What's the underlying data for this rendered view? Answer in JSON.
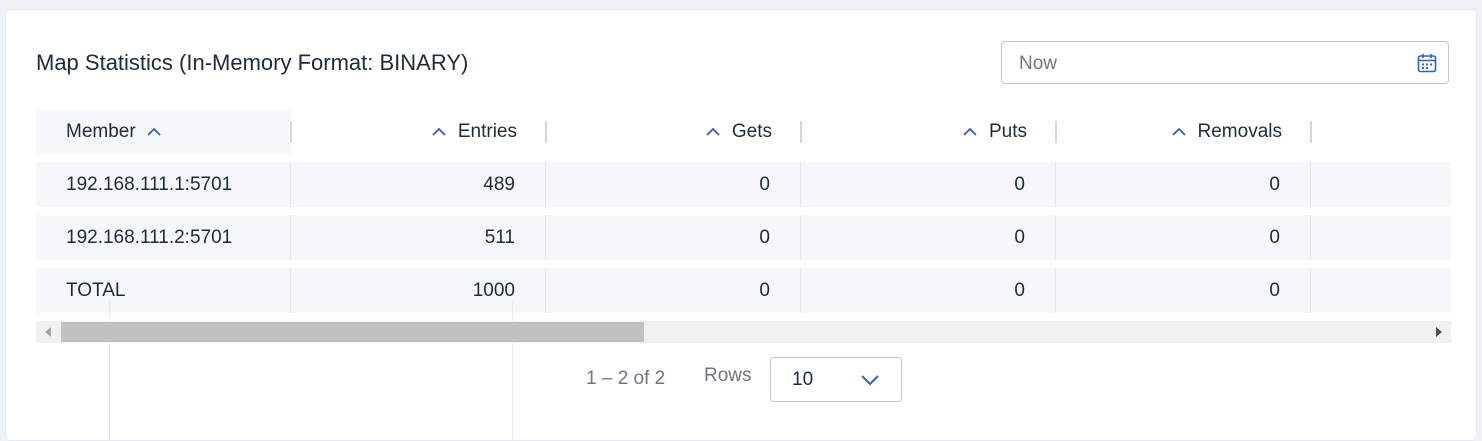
{
  "header": {
    "title": "Map Statistics (In-Memory Format: BINARY)",
    "date_value": "Now",
    "calendar_icon": "calendar-icon"
  },
  "table": {
    "columns": [
      {
        "label": "Member",
        "sort": "asc"
      },
      {
        "label": "Entries",
        "sort": "asc"
      },
      {
        "label": "Gets",
        "sort": "asc"
      },
      {
        "label": "Puts",
        "sort": "asc"
      },
      {
        "label": "Removals",
        "sort": "asc"
      }
    ],
    "rows": [
      [
        "192.168.111.1:5701",
        "489",
        "0",
        "0",
        "0"
      ],
      [
        "192.168.111.2:5701",
        "511",
        "0",
        "0",
        "0"
      ],
      [
        "TOTAL",
        "1000",
        "0",
        "0",
        "0"
      ]
    ]
  },
  "pagination": {
    "range": "1 – 2 of 2",
    "rows_label": "Rows",
    "rows_value": "10",
    "chevron_icon": "chevron-down-icon"
  },
  "colors": {
    "accent": "#2f63b8",
    "text": "#1d2b3a",
    "muted": "#6f7680",
    "row_bg": "#f6f7f8"
  }
}
